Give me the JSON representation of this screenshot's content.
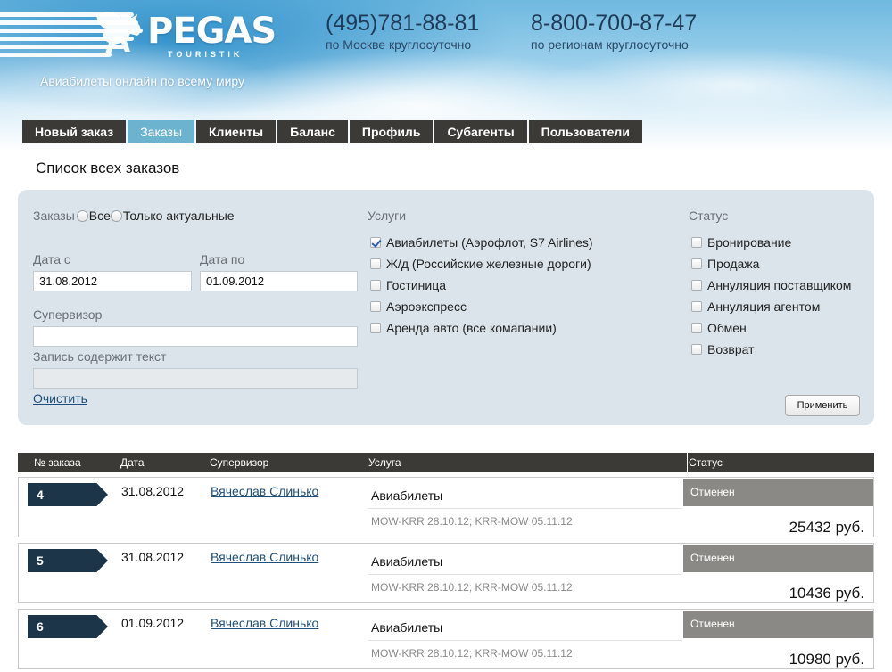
{
  "header": {
    "logo_text": "PEGAS",
    "logo_sub": "TOURISTIK",
    "tagline": "Авиабилеты онлайн по всему миру",
    "phone1": {
      "number": "(495)781-88-81",
      "note": "по Москве круглосуточно"
    },
    "phone2": {
      "number": "8-800-700-87-47",
      "note": "по регионам круглосуточно"
    }
  },
  "nav": {
    "items": [
      {
        "label": "Новый заказ",
        "active": false
      },
      {
        "label": "Заказы",
        "active": true
      },
      {
        "label": "Клиенты",
        "active": false
      },
      {
        "label": "Баланс",
        "active": false
      },
      {
        "label": "Профиль",
        "active": false
      },
      {
        "label": "Субагенты",
        "active": false
      },
      {
        "label": "Пользователи",
        "active": false
      }
    ]
  },
  "page_title": "Список всех заказов",
  "filter": {
    "orders_label": "Заказы",
    "radio_all": "Все",
    "radio_actual": "Только актуальные",
    "date_from_label": "Дата с",
    "date_from_value": "31.08.2012",
    "date_to_label": "Дата по",
    "date_to_value": "01.09.2012",
    "supervisor_label": "Супервизор",
    "supervisor_value": "",
    "text_label": "Запись содержит текст",
    "text_value": "",
    "clear_link": "Очистить",
    "services_label": "Услуги",
    "services": [
      {
        "label": "Авиабилеты (Аэрофлот, S7 Airlines)",
        "checked": true
      },
      {
        "label": "Ж/д (Российские железные дороги)",
        "checked": false
      },
      {
        "label": "Гостиница",
        "checked": false
      },
      {
        "label": "Аэроэкспресс",
        "checked": false
      },
      {
        "label": "Аренда авто (все комапании)",
        "checked": false
      }
    ],
    "status_label": "Статус",
    "statuses": [
      {
        "label": "Бронирование",
        "checked": false
      },
      {
        "label": "Продажа",
        "checked": false
      },
      {
        "label": "Аннуляция поставщиком",
        "checked": false
      },
      {
        "label": "Аннуляция агентом",
        "checked": false
      },
      {
        "label": "Обмен",
        "checked": false
      },
      {
        "label": "Возврат",
        "checked": false
      }
    ],
    "apply_button": "Применить"
  },
  "table": {
    "headers": {
      "num": "№ заказа",
      "date": "Дата",
      "supervisor": "Супервизор",
      "service": "Услуга",
      "status": "Статус"
    },
    "rows": [
      {
        "num": "4",
        "date": "31.08.2012",
        "supervisor": "Вячеслав Слинько",
        "service": "Авиабилеты",
        "route": "MOW-KRR 28.10.12; KRR-MOW 05.11.12",
        "status": "Отменен",
        "price": "25432 руб."
      },
      {
        "num": "5",
        "date": "31.08.2012",
        "supervisor": "Вячеслав Слинько",
        "service": "Авиабилеты",
        "route": "MOW-KRR 28.10.12; KRR-MOW 05.11.12",
        "status": "Отменен",
        "price": "10436 руб."
      },
      {
        "num": "6",
        "date": "01.09.2012",
        "supervisor": "Вячеслав Слинько",
        "service": "Авиабилеты",
        "route": "MOW-KRR 28.10.12; KRR-MOW 05.11.12",
        "status": "Отменен",
        "price": "10980 руб."
      }
    ]
  },
  "colors": {
    "nav_bg": "#3c3a37",
    "nav_active": "#6cb3cf",
    "panel_bg": "#dbe4ea",
    "order_num_bg": "#1d3548",
    "status_bg": "#8b8985",
    "link": "#1f4f7a"
  }
}
